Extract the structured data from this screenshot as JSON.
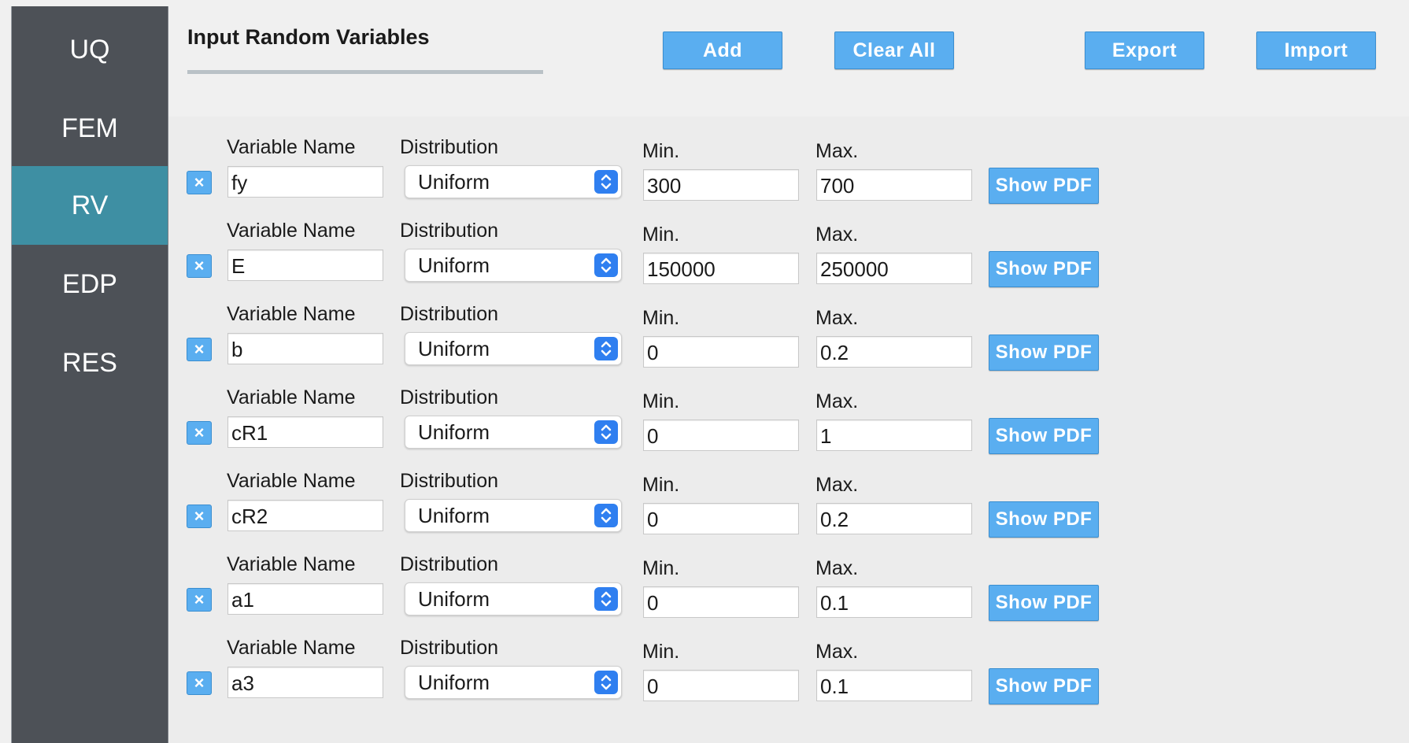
{
  "sidebar": {
    "items": [
      {
        "label": "UQ",
        "active": false
      },
      {
        "label": "FEM",
        "active": false
      },
      {
        "label": "RV",
        "active": true
      },
      {
        "label": "EDP",
        "active": false
      },
      {
        "label": "RES",
        "active": false
      }
    ]
  },
  "header": {
    "title": "Input Random Variables",
    "buttons": {
      "add": "Add",
      "clear_all": "Clear All",
      "export": "Export",
      "import": "Import"
    }
  },
  "labels": {
    "variable_name": "Variable Name",
    "distribution": "Distribution",
    "min": "Min.",
    "max": "Max.",
    "show_pdf": "Show PDF",
    "remove_glyph": "×"
  },
  "variables": [
    {
      "name": "fy",
      "distribution": "Uniform",
      "min": "300",
      "max": "700"
    },
    {
      "name": "E",
      "distribution": "Uniform",
      "min": "150000",
      "max": "250000"
    },
    {
      "name": "b",
      "distribution": "Uniform",
      "min": "0",
      "max": "0.2"
    },
    {
      "name": "cR1",
      "distribution": "Uniform",
      "min": "0",
      "max": "1"
    },
    {
      "name": "cR2",
      "distribution": "Uniform",
      "min": "0",
      "max": "0.2"
    },
    {
      "name": "a1",
      "distribution": "Uniform",
      "min": "0",
      "max": "0.1"
    },
    {
      "name": "a3",
      "distribution": "Uniform",
      "min": "0",
      "max": "0.1"
    }
  ],
  "colors": {
    "sidebar_bg": "#4d5157",
    "sidebar_active": "#3e8fa3",
    "button_blue": "#5aaef0",
    "select_arrow_blue": "#2f7ff0"
  }
}
